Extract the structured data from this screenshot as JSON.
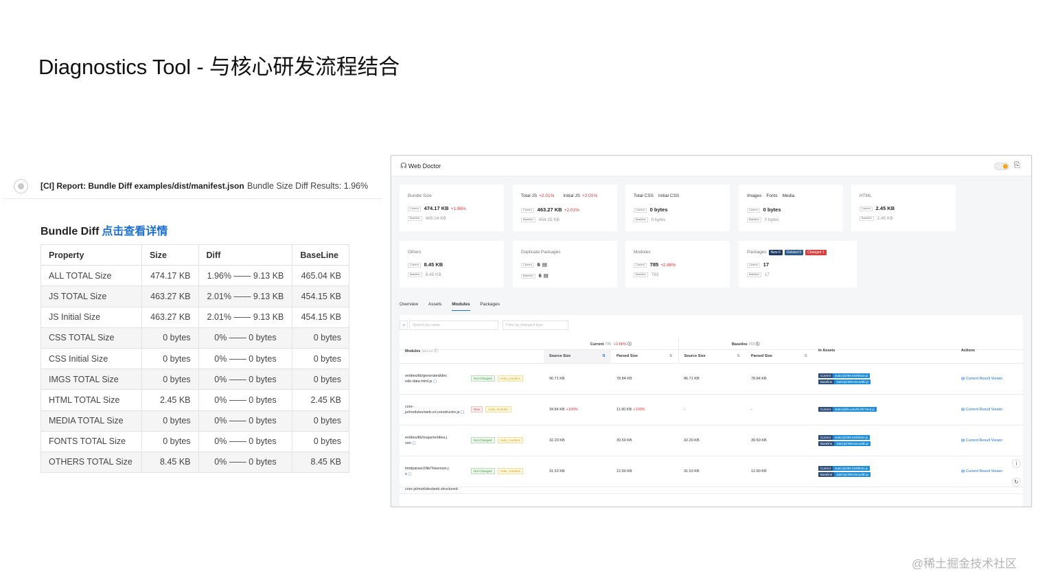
{
  "slide": {
    "title": "Diagnostics Tool - 与核心研发流程结合",
    "watermark": "@稀土掘金技术社区"
  },
  "ci": {
    "report_title": "[CI] Report: Bundle Diff examples/dist/manifest.json",
    "result": "Bundle Size Diff Results: 1.96%",
    "heading": "Bundle Diff",
    "heading_link": "点击查看详情",
    "table": {
      "headers": [
        "Property",
        "Size",
        "Diff",
        "BaseLine"
      ],
      "rows": [
        [
          "ALL TOTAL Size",
          "474.17 KB",
          "1.96% —— 9.13 KB",
          "465.04 KB"
        ],
        [
          "JS TOTAL Size",
          "463.27 KB",
          "2.01% —— 9.13 KB",
          "454.15 KB"
        ],
        [
          "JS Initial Size",
          "463.27 KB",
          "2.01% —— 9.13 KB",
          "454.15 KB"
        ],
        [
          "CSS TOTAL Size",
          "0 bytes",
          "0% —— 0 bytes",
          "0 bytes"
        ],
        [
          "CSS Initial Size",
          "0 bytes",
          "0% —— 0 bytes",
          "0 bytes"
        ],
        [
          "IMGS TOTAL Size",
          "0 bytes",
          "0% —— 0 bytes",
          "0 bytes"
        ],
        [
          "HTML TOTAL Size",
          "2.45 KB",
          "0% —— 0 bytes",
          "2.45 KB"
        ],
        [
          "MEDIA TOTAL Size",
          "0 bytes",
          "0% —— 0 bytes",
          "0 bytes"
        ],
        [
          "FONTS TOTAL Size",
          "0 bytes",
          "0% —— 0 bytes",
          "0 bytes"
        ],
        [
          "OTHERS TOTAL Size",
          "8.45 KB",
          "0% —— 0 bytes",
          "8.45 KB"
        ]
      ]
    }
  },
  "webdoctor": {
    "app_title": "Web Doctor",
    "labels": {
      "current": "Current",
      "baseline": "Baseline"
    },
    "cards": {
      "bundle": {
        "title": "Bundle Size",
        "current": "474.17 KB",
        "delta": "+1.96%",
        "baseline": "465.04 KB"
      },
      "js": {
        "tab1": "Total JS",
        "tab1_delta": "+2.01%",
        "tab2": "Initial JS",
        "tab2_delta": "+2.01%",
        "current": "463.27 KB",
        "delta": "+2.01%",
        "baseline": "454.15 KB"
      },
      "css": {
        "tab1": "Total CSS",
        "tab2": "Initial CSS",
        "current": "0 bytes",
        "baseline": "0 bytes"
      },
      "media": {
        "tab1": "Images",
        "tab2": "Fonts",
        "tab3": "Media",
        "current": "0 bytes",
        "baseline": "0 bytes"
      },
      "html": {
        "title": "HTML",
        "current": "2.45 KB",
        "baseline": "2.45 KB"
      },
      "others": {
        "title": "Others",
        "current": "8.45 KB",
        "baseline": "8.45 KB"
      },
      "dup": {
        "title": "Duplicate Packages",
        "current": "6",
        "baseline": "6"
      },
      "modules": {
        "title": "Modules",
        "current": "785",
        "delta": "+2.88%",
        "baseline": "763"
      },
      "packages": {
        "title": "Packages",
        "new": "New",
        "new_count": "0",
        "deleted": "Deleted",
        "deleted_count": "0",
        "changed": "Changed",
        "changed_count": "1",
        "current": "17",
        "baseline": "17"
      }
    },
    "tabs": [
      "Overview",
      "Assets",
      "Modules",
      "Packages"
    ],
    "search_placeholder": "Search by name",
    "filter_placeholder": "Filter by changed type",
    "table": {
      "current": "Current",
      "current_count": "785",
      "current_delta": "+2.88%",
      "baseline": "Baseline",
      "baseline_count": "763",
      "modules": "Modules",
      "modules_count": "785/1/1/3",
      "in_assets": "In Assets",
      "actions": "Actions",
      "source_size": "Source Size",
      "parsed_size": "Parsed Size",
      "viewer": "Current Result Viewer",
      "rows": [
        {
          "path1": "entities/lib/generated/dec",
          "path2": "ode-data-html.js",
          "status": "Not Changed",
          "type": "node_modules",
          "cur_src": "96.71 KB",
          "cur_src_d": "",
          "cur_parsed": "78.84 KB",
          "cur_parsed_d": "",
          "base_src": "96.71 KB",
          "base_parsed": "78.84 KB",
          "asset_cur": "static/js/399.033fd53e.js",
          "asset_base": "static/js/399.8a1ad9b.js"
        },
        {
          "path1": "core-",
          "path2": "js/modules/web.url.constructor.js",
          "status": "New",
          "type": "node_modules",
          "cur_src": "34.84 KB",
          "cur_src_d": "+100%",
          "cur_parsed": "11.90 KB",
          "cur_parsed_d": "+100%",
          "base_src": "-",
          "base_parsed": "-",
          "asset_cur": "static/js/lib-polyfill.effc70ed.js",
          "asset_base": ""
        },
        {
          "path1": "entities/lib/maps/entities.j",
          "path2": "son",
          "status": "Not Changed",
          "type": "node_modules",
          "cur_src": "32.20 KB",
          "cur_src_d": "",
          "cur_parsed": "39.50 KB",
          "cur_parsed_d": "",
          "base_src": "32.20 KB",
          "base_parsed": "39.50 KB",
          "asset_cur": "static/js/399.033fd53e.js",
          "asset_base": "static/js/399.8a1ad9b.js"
        },
        {
          "path1": "htmlparser2/lib/Tokenizer.j",
          "path2": "s",
          "status": "Not Changed",
          "type": "node_modules",
          "cur_src": "31.53 KB",
          "cur_src_d": "",
          "cur_parsed": "12.90 KB",
          "cur_parsed_d": "",
          "base_src": "31.53 KB",
          "base_parsed": "12.90 KB",
          "asset_cur": "static/js/399.033fd53e.js",
          "asset_base": "static/js/399.8a1ad9b.js"
        }
      ],
      "cut_row": "core-js/modules/web.structured-"
    }
  }
}
